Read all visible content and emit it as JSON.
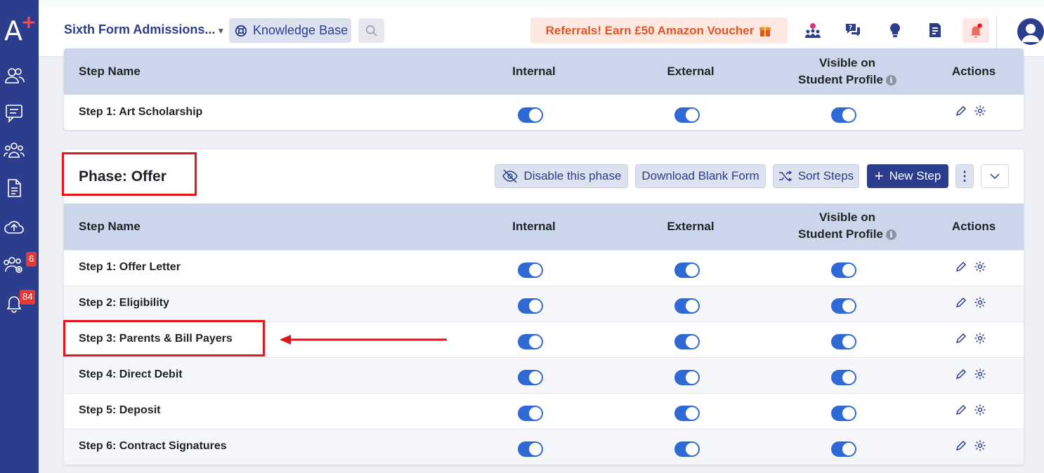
{
  "header": {
    "school": "Sixth Form Admissions...",
    "knowledge_base": "Knowledge Base",
    "referral": "Referrals! Earn £50 Amazon Voucher"
  },
  "sidebar": {
    "badges": {
      "users_settings": "6",
      "notifications": "84"
    }
  },
  "table_columns": {
    "step_name": "Step Name",
    "internal": "Internal",
    "external": "External",
    "visible_line1": "Visible on",
    "visible_line2": "Student Profile",
    "actions": "Actions"
  },
  "prev_phase": {
    "steps": [
      {
        "name": "Step 1: Art Scholarship",
        "internal": true,
        "external": true,
        "visible": true
      }
    ]
  },
  "offer_phase": {
    "title": "Phase: Offer",
    "buttons": {
      "disable": "Disable this phase",
      "download": "Download Blank Form",
      "sort": "Sort Steps",
      "new_step": "New Step"
    },
    "steps": [
      {
        "name": "Step 1: Offer Letter",
        "internal": true,
        "external": true,
        "visible": true
      },
      {
        "name": "Step 2: Eligibility",
        "internal": true,
        "external": true,
        "visible": true
      },
      {
        "name": "Step 3: Parents & Bill Payers",
        "internal": true,
        "external": true,
        "visible": true
      },
      {
        "name": "Step 4: Direct Debit",
        "internal": true,
        "external": true,
        "visible": true
      },
      {
        "name": "Step 5: Deposit",
        "internal": true,
        "external": true,
        "visible": true
      },
      {
        "name": "Step 6: Contract Signatures",
        "internal": true,
        "external": true,
        "visible": true
      }
    ]
  },
  "colors": {
    "sidebar": "#2b3d8c",
    "toggle_on": "#2f69d6",
    "table_header": "#ccd6ea",
    "annotation": "#e8121b",
    "referral_text": "#e2542a"
  }
}
